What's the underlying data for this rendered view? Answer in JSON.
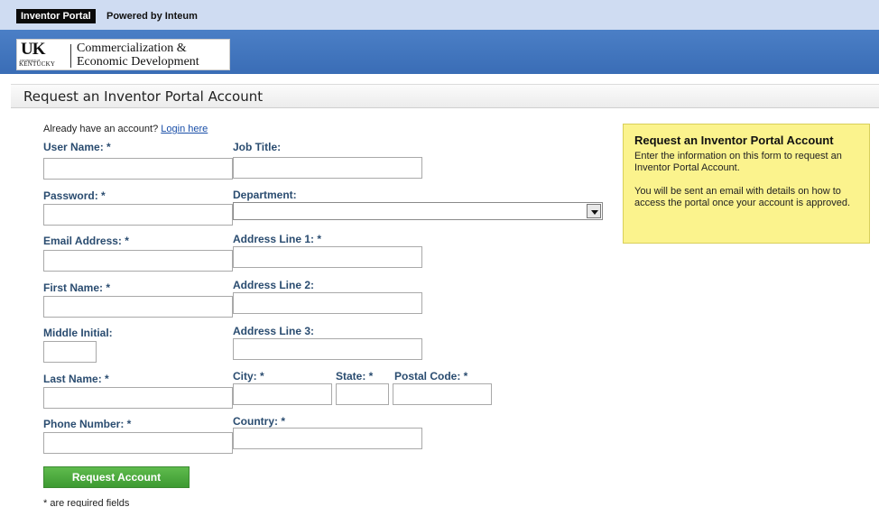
{
  "topbar": {
    "portal_label": "Inventor Portal",
    "powered_label": "Powered by Inteum"
  },
  "logo": {
    "uk": "UK",
    "university": "UNIVERSITY OF",
    "kentucky": "KENTUCKY",
    "line1": "Commercialization &",
    "line2": "Economic Development"
  },
  "page": {
    "title": "Request an Inventor Portal Account"
  },
  "login_prompt": {
    "text": "Already have an account? ",
    "link": "Login here"
  },
  "form": {
    "left": [
      {
        "label": "User Name: *",
        "value": ""
      },
      {
        "label": "Password: *",
        "value": ""
      },
      {
        "label": "Email Address: *",
        "value": ""
      },
      {
        "label": "First Name: *",
        "value": ""
      },
      {
        "label": "Middle Initial:",
        "value": ""
      },
      {
        "label": "Last Name: *",
        "value": ""
      },
      {
        "label": "Phone Number: *",
        "value": ""
      }
    ],
    "right": {
      "job_title": {
        "label": "Job Title:",
        "value": ""
      },
      "department": {
        "label": "Department:",
        "selected": ""
      },
      "address1": {
        "label": "Address Line 1: *",
        "value": ""
      },
      "address2": {
        "label": "Address Line 2:",
        "value": ""
      },
      "address3": {
        "label": "Address Line 3:",
        "value": ""
      },
      "city": {
        "label": "City: *",
        "value": ""
      },
      "state": {
        "label": "State: *",
        "value": ""
      },
      "postal": {
        "label": "Postal Code: *",
        "value": ""
      },
      "country": {
        "label": "Country: *",
        "value": ""
      }
    },
    "submit_label": "Request Account",
    "required_note": "* are required fields"
  },
  "infobox": {
    "title": "Request an Inventor Portal Account",
    "para1": "Enter the information on this form to request an Inventor Portal Account.",
    "para2": "You will be sent an email with details on how to access the portal once your account is approved.",
    "background": "#fbf38d"
  },
  "colors": {
    "banner": "#3f74bd",
    "label": "#2a4c70",
    "button": "#4aa83c"
  }
}
